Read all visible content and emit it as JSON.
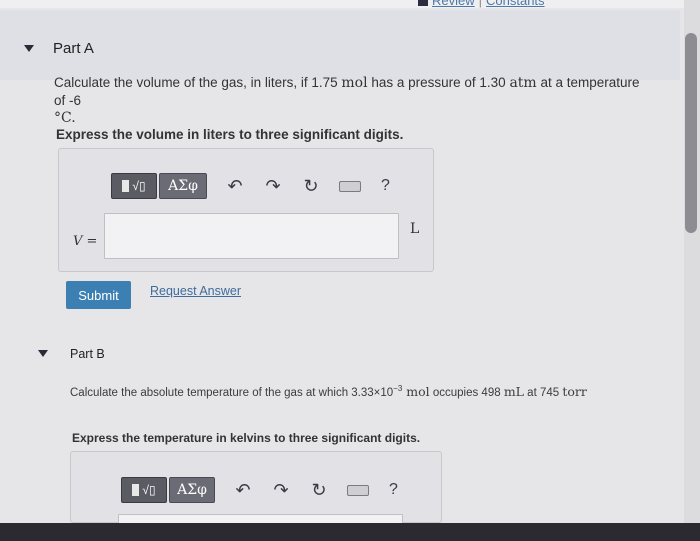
{
  "header": {
    "links": [
      "Review",
      "Constants"
    ]
  },
  "part_a": {
    "title": "Part A",
    "question_line1_pre": "Calculate the volume of the gas, in liters, if 1.75 ",
    "q_unit_mol": "mol",
    "question_line1_mid": " has a pressure of 1.30 ",
    "q_unit_atm": "atm",
    "question_line1_post": " at a temperature of -6",
    "question_line2": "°C.",
    "instruction": "Express the volume in liters to three significant digits.",
    "toolbar": {
      "templates_label": "√▯",
      "greek_label": "ΑΣφ",
      "help_label": "?"
    },
    "variable": "V =",
    "unit": "L",
    "answer_value": "",
    "submit_label": "Submit",
    "request_label": "Request Answer"
  },
  "part_b": {
    "title": "Part B",
    "question_pre": "Calculate the absolute temperature of the gas at which 3.33×10",
    "question_exp": "−3",
    "q_unit_mol": " mol",
    "question_mid": " occupies 498 ",
    "q_unit_ml": "mL",
    "question_mid2": " at 745 ",
    "q_unit_torr": "torr",
    "instruction": "Express the temperature in kelvins to three significant digits.",
    "toolbar": {
      "templates_label": "√▯",
      "greek_label": "ΑΣφ",
      "help_label": "?"
    }
  }
}
